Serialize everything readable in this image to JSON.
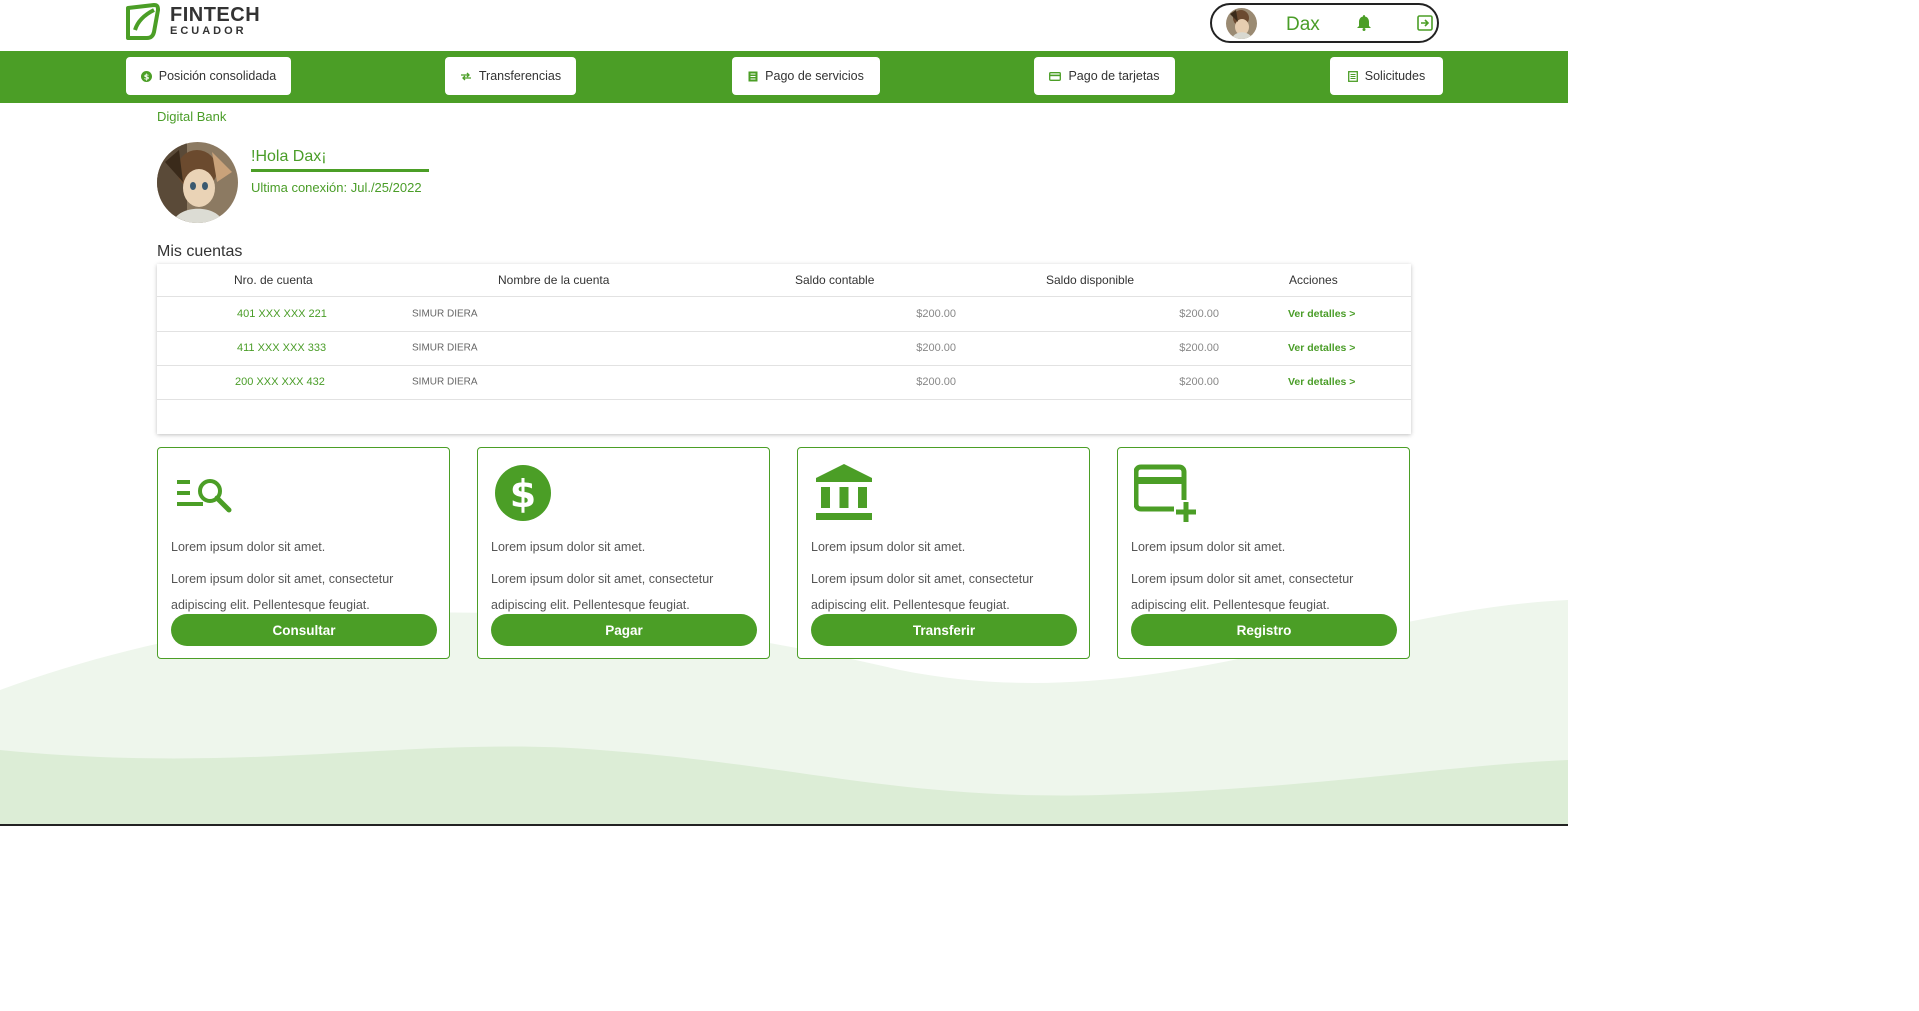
{
  "brand": {
    "name_line1": "FINTECH",
    "name_line2": "ECUADOR"
  },
  "user": {
    "name": "Dax"
  },
  "nav": [
    {
      "label": "Posición consolidada",
      "icon": "dollar-circle-icon"
    },
    {
      "label": "Transferencias",
      "icon": "transfer-arrows-icon"
    },
    {
      "label": "Pago de servicios",
      "icon": "receipt-icon"
    },
    {
      "label": "Pago de tarjetas",
      "icon": "credit-card-icon"
    },
    {
      "label": "Solicitudes",
      "icon": "document-list-icon"
    }
  ],
  "breadcrumb": "Digital Bank",
  "greeting": {
    "title": "!Hola Dax¡",
    "last_connection": "Ultima conexión: Jul./25/2022"
  },
  "accounts": {
    "title": "Mis cuentas",
    "columns": [
      "Nro. de cuenta",
      "Nombre de la cuenta",
      "Saldo contable",
      "Saldo disponible",
      "Acciones"
    ],
    "rows": [
      {
        "number": "401 XXX XXX 221",
        "name": "SIMUR DIERA",
        "balance": "$200.00",
        "available": "$200.00",
        "action": "Ver detalles >"
      },
      {
        "number": "411 XXX XXX 333",
        "name": "SIMUR DIERA",
        "balance": "$200.00",
        "available": "$200.00",
        "action": "Ver detalles >"
      },
      {
        "number": "200 XXX XXX 432",
        "name": "SIMUR DIERA",
        "balance": "$200.00",
        "available": "$200.00",
        "action": "Ver detalles >"
      }
    ]
  },
  "cards": [
    {
      "icon": "search-list-icon",
      "line1": "Lorem ipsum dolor sit amet.",
      "line2": "Lorem ipsum dolor sit amet, consectetur adipiscing elit. Pellentesque feugiat.",
      "button": "Consultar"
    },
    {
      "icon": "dollar-coin-icon",
      "line1": "Lorem ipsum dolor sit amet.",
      "line2": "Lorem ipsum dolor sit amet, consectetur adipiscing elit. Pellentesque feugiat.",
      "button": "Pagar"
    },
    {
      "icon": "bank-icon",
      "line1": "Lorem ipsum dolor sit amet.",
      "line2": "Lorem ipsum dolor sit amet, consectetur adipiscing elit. Pellentesque feugiat.",
      "button": "Transferir"
    },
    {
      "icon": "add-card-icon",
      "line1": "Lorem ipsum dolor sit amet.",
      "line2": "Lorem ipsum dolor sit amet, consectetur adipiscing elit. Pellentesque feugiat.",
      "button": "Registro"
    }
  ],
  "colors": {
    "primary": "#4b9e26",
    "text_green": "#4a9d28",
    "wave_light": "#eef6ec",
    "wave_mid": "#dcedd6"
  }
}
